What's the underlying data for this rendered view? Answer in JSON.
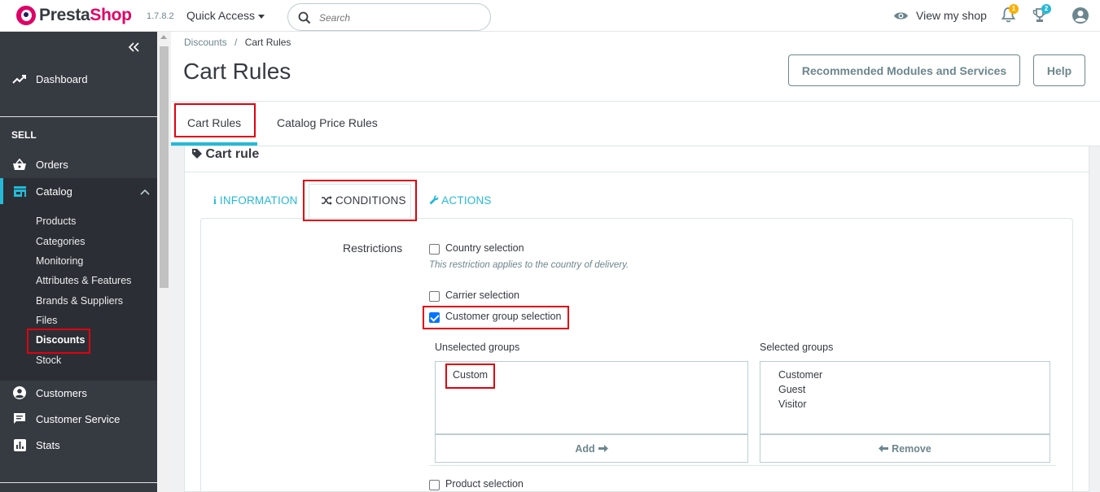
{
  "header": {
    "brand_presta": "Presta",
    "brand_shop": "Shop",
    "version": "1.7.8.2",
    "quick_access": "Quick Access",
    "search_placeholder": "Search",
    "view_shop": "View my shop",
    "notifications_count": "1",
    "trophy_count": "2"
  },
  "sidebar": {
    "dashboard": "Dashboard",
    "sell_title": "SELL",
    "orders": "Orders",
    "catalog": "Catalog",
    "catalog_items": [
      "Products",
      "Categories",
      "Monitoring",
      "Attributes & Features",
      "Brands & Suppliers",
      "Files",
      "Discounts",
      "Stock"
    ],
    "customers": "Customers",
    "customer_service": "Customer Service",
    "stats": "Stats"
  },
  "page": {
    "breadcrumb_parent": "Discounts",
    "breadcrumb_sep": "/",
    "breadcrumb_current": "Cart Rules",
    "title": "Cart Rules",
    "btn_recommended": "Recommended Modules and Services",
    "btn_help": "Help",
    "tabs": [
      "Cart Rules",
      "Catalog Price Rules"
    ]
  },
  "panel": {
    "heading": "Cart rule",
    "subtabs": {
      "information": "INFORMATION",
      "conditions": "CONDITIONS",
      "actions": "ACTIONS"
    },
    "restrictions_label": "Restrictions",
    "country_selection": "Country selection",
    "country_help": "This restriction applies to the country of delivery.",
    "carrier_selection": "Carrier selection",
    "customer_group_selection": "Customer group selection",
    "unselected_groups_label": "Unselected groups",
    "selected_groups_label": "Selected groups",
    "unselected_groups": [
      "Custom"
    ],
    "selected_groups": [
      "Customer",
      "Guest",
      "Visitor"
    ],
    "add_btn": "Add",
    "remove_btn": "Remove",
    "product_selection": "Product selection"
  },
  "colors": {
    "accent": "#25b9d7",
    "sidebar": "#363a41",
    "brand_pink": "#df0067",
    "highlight_red": "#e0000f"
  }
}
